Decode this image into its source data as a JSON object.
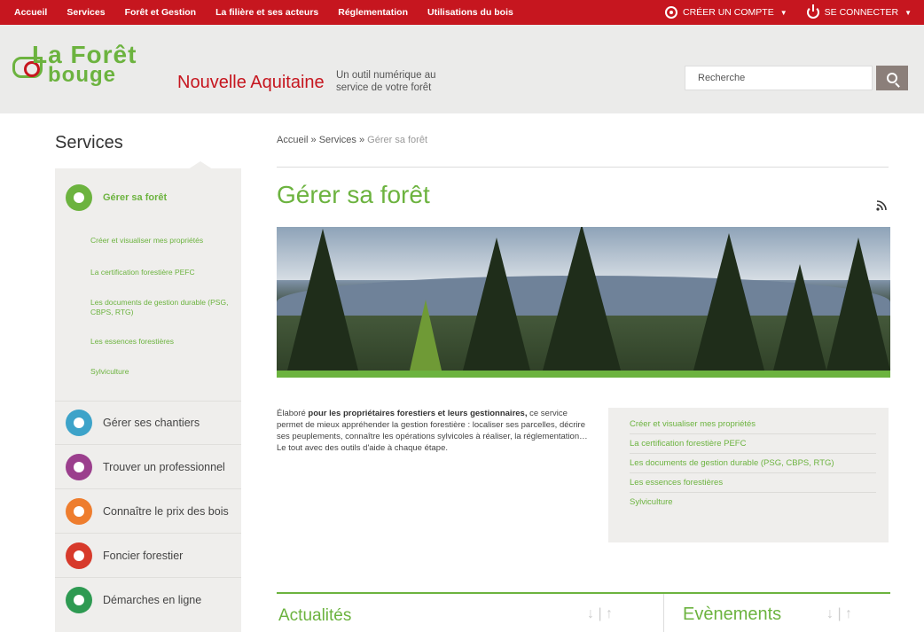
{
  "topnav": {
    "items": [
      "Accueil",
      "Services",
      "Forêt et Gestion",
      "La filière et ses acteurs",
      "Réglementation",
      "Utilisations du bois"
    ],
    "create_account": "CRÉER UN COMPTE",
    "login": "SE CONNECTER"
  },
  "header": {
    "logo_line1": "La Forêt",
    "logo_line2": "bouge",
    "region": "Nouvelle Aquitaine",
    "tagline": "Un outil numérique au service de votre forêt",
    "search_placeholder": "Recherche"
  },
  "sidebar": {
    "title": "Services",
    "active": "Gérer sa forêt",
    "subitems": [
      "Créer et visualiser mes propriétés",
      "La certification forestière PEFC",
      "Les documents de gestion durable (PSG, CBPS, RTG)",
      "Les essences forestières",
      "Sylviculture"
    ],
    "services": [
      "Gérer ses chantiers",
      "Trouver un professionnel",
      "Connaître le prix des bois",
      "Foncier forestier",
      "Démarches en ligne"
    ]
  },
  "breadcrumb": {
    "home": "Accueil",
    "services": "Services",
    "current": "Gérer sa forêt",
    "sep": "»"
  },
  "main": {
    "title": "Gérer sa forêt",
    "intro_lead": "Élaboré ",
    "intro_bold": "pour les propriétaires forestiers et leurs gestionnaires,",
    "intro_rest": " ce service permet de mieux appréhender la gestion forestière : localiser ses parcelles, décrire ses peuplements, connaître les opérations sylvicoles à réaliser, la réglementation… Le tout avec des outils d'aide à chaque étape.",
    "links": [
      "Créer et visualiser mes propriétés",
      "La certification forestière PEFC",
      "Les documents de gestion durable (PSG, CBPS, RTG)",
      "Les essences forestières",
      "Sylviculture"
    ],
    "news_title": "Actualités",
    "events_title": "Evènements",
    "arrows": "↓ | ↑"
  },
  "colors": {
    "brand_red": "#c6161f",
    "brand_green": "#6cb33f",
    "icon_colors": [
      "#6cb33f",
      "#3da3c9",
      "#9b3f8d",
      "#ee7d2e",
      "#d73a2b",
      "#2e9a52"
    ]
  }
}
